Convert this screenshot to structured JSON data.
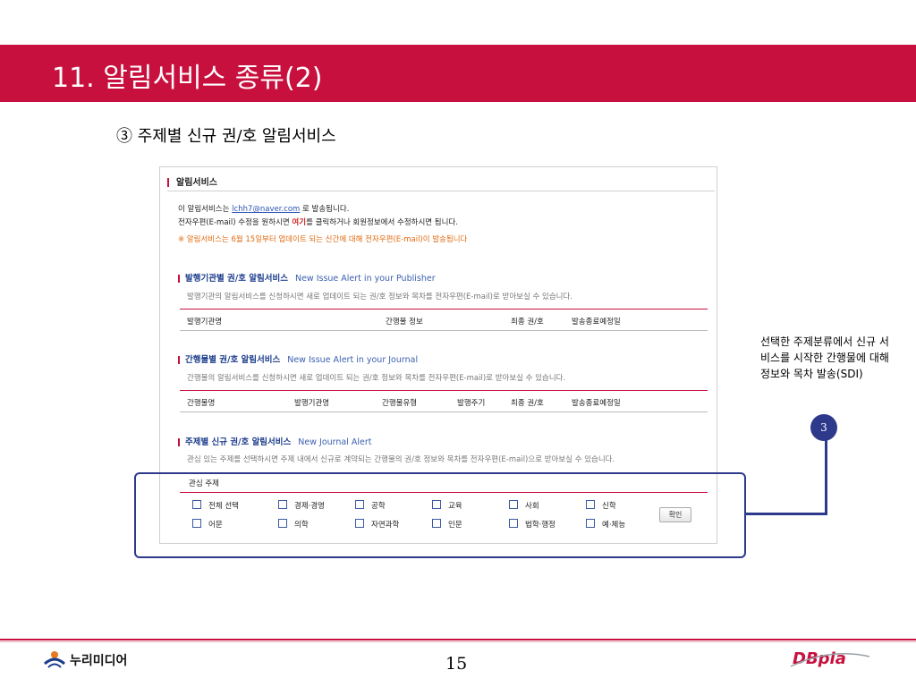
{
  "slide": {
    "title": "11. 알림서비스 종류(2)",
    "subtitle": "③ 주제별 신규 권/호 알림서비스",
    "page_number": "15"
  },
  "screenshot": {
    "section_title": "알림서비스",
    "notice": {
      "line1_prefix": "이 알림서비스는 ",
      "email": "lchh7@naver.com",
      "line1_suffix": " 로 발송됩니다.",
      "line2_prefix": "전자우편(E-mail) 수정을 원하시면 ",
      "line2_link": "여기",
      "line2_suffix": "를 클릭하거나 회원정보에서 수정하시면 됩니다.",
      "line3": "※ 알림서비스는 6월 15일부터 업데이트 되는 신간에 대해 전자우편(E-mail)이 발송됩니다"
    },
    "publisher": {
      "title": "발행기관별 권/호 알림서비스",
      "title_en": "New Issue Alert in your Publisher",
      "desc": "발행기관의 알림서비스를 신청하시면 새로 업데이트 되는 권/호 정보와 목차를 전자우편(E-mail)로 받아보실 수 있습니다.",
      "columns": [
        "발행기관명",
        "간행물 정보",
        "최종 권/호",
        "발송종료예정일"
      ]
    },
    "journal": {
      "title": "간행물별 권/호 알림서비스",
      "title_en": "New Issue Alert in your Journal",
      "desc": "간행물의 알림서비스를 신청하시면 새로 업데이트 되는 권/호 정보와 목차를 전자우편(E-mail)로 받아보실 수 있습니다.",
      "columns": [
        "간행물명",
        "발행기관명",
        "간행물유형",
        "발행주기",
        "최종 권/호",
        "발송종료예정일"
      ]
    },
    "subject": {
      "title": "주제별 신규 권/호 알림서비스",
      "title_en": "New Journal Alert",
      "desc": "관심 있는 주제를 선택하시면 주제 내에서 신규로 계약되는 간행물의 권/호 정보와 목차를 전자우편(E-mail)으로 받아보실 수 있습니다.",
      "interest_label": "관심 주제",
      "options": [
        "전체 선택",
        "경제·경영",
        "공학",
        "교육",
        "사회",
        "신학",
        "어문",
        "의학",
        "자연과학",
        "인문",
        "법학·행정",
        "예·체능"
      ],
      "confirm_label": "확인"
    }
  },
  "callout": {
    "step": "3",
    "text": "선택한 주제분류에서 신규 서비스를 시작한 간행물에 대해 정보와 목차 발송(SDI)"
  },
  "footer": {
    "left_logo": "누리미디어",
    "right_logo": "DBpia"
  },
  "colors": {
    "brand_red": "#c8103e",
    "highlight_navy": "#2d3a8c",
    "link_blue": "#2a55b4",
    "notice_orange": "#e26a10"
  }
}
